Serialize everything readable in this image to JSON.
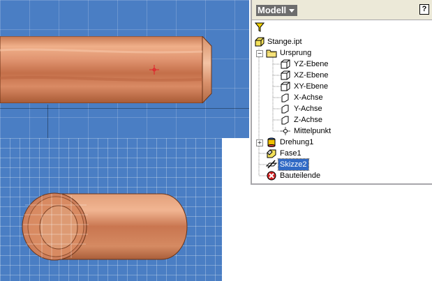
{
  "browser": {
    "title": "Modell",
    "help_label": "?",
    "tree": {
      "root": "Stange.ipt",
      "origin": "Ursprung",
      "origin_items": [
        "YZ-Ebene",
        "XZ-Ebene",
        "XY-Ebene",
        "X-Achse",
        "Y-Achse",
        "Z-Achse",
        "Mittelpunkt"
      ],
      "features": [
        "Drehung1",
        "Fase1",
        "Skizze2",
        "Bauteilende"
      ],
      "selected": "Skizze2"
    }
  },
  "colors": {
    "viewport_bg": "#4a7ec4",
    "selection": "#316ac5",
    "copper": "#d98a5c",
    "panel_header": "#ece9d8"
  },
  "icons": [
    "part-icon",
    "folder-icon",
    "plane-icon",
    "axis-icon",
    "point-icon",
    "revolve-icon",
    "chamfer-icon",
    "sketch-icon",
    "end-of-part-icon",
    "filter-icon"
  ]
}
